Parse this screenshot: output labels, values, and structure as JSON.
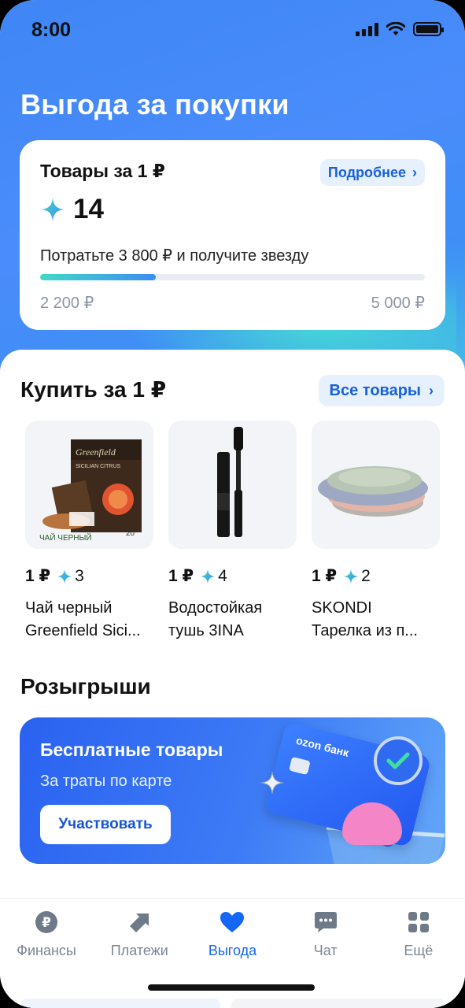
{
  "status_bar": {
    "time": "8:00"
  },
  "hero": {
    "title": "Выгода за покупки"
  },
  "promo_card": {
    "title": "Товары за 1 ₽",
    "more_button": "Подробнее",
    "stars": "14",
    "hint": "Потратьте 3 800 ₽ и получите звезду",
    "progress_fraction": 0.3,
    "range_min": "2 200 ₽",
    "range_max": "5 000 ₽"
  },
  "buy_section": {
    "title": "Купить за 1 ₽",
    "all_button": "Все товары",
    "products": [
      {
        "price": "1 ₽",
        "stars": "3",
        "name_line1": "Чай черный",
        "name_line2": "Greenfield Sici...",
        "image": "tea-box"
      },
      {
        "price": "1 ₽",
        "stars": "4",
        "name_line1": "Водостойкая",
        "name_line2": "тушь 3INA",
        "image": "mascara"
      },
      {
        "price": "1 ₽",
        "stars": "2",
        "name_line1": "SKONDI",
        "name_line2": "Тарелка из п...",
        "image": "plates"
      }
    ]
  },
  "draws_section": {
    "title": "Розыгрыши",
    "card_title": "Бесплатные товары",
    "card_subtitle": "За траты по карте",
    "join_button": "Участвовать",
    "card_brand": "ozon банк"
  },
  "bottom_nav": {
    "items": [
      {
        "label": "Финансы",
        "icon": "ruble-icon",
        "active": false
      },
      {
        "label": "Платежи",
        "icon": "transfer-icon",
        "active": false
      },
      {
        "label": "Выгода",
        "icon": "heart-icon",
        "active": true
      },
      {
        "label": "Чат",
        "icon": "chat-icon",
        "active": false
      },
      {
        "label": "Ещё",
        "icon": "grid-icon",
        "active": false
      }
    ]
  },
  "colors": {
    "accent": "#1467f5",
    "hero": "#4a8cfb",
    "star": "#42d9c6"
  },
  "product_images": {
    "tea_brand": "Greenfield",
    "tea_flavor": "SICILIAN CITRUS",
    "tea_caption": "ЧАЙ ЧЕРНЫЙ",
    "tea_count": "20"
  }
}
